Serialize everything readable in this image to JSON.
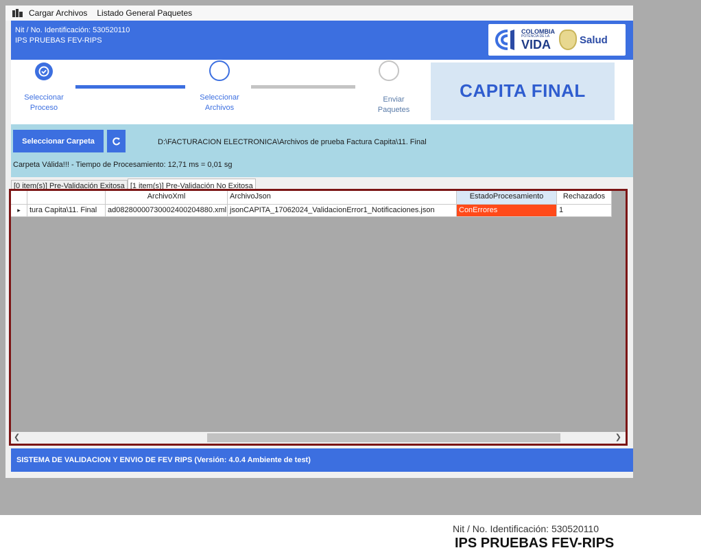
{
  "menubar": {
    "icon": "app-menu-icon",
    "items": [
      "Cargar Archivos",
      "Listado General Paquetes"
    ]
  },
  "header": {
    "nit": "Nit / No. Identificación: 530520110",
    "ips": "IPS PRUEBAS FEV-RIPS",
    "logo": {
      "colombia": "COLOMBIA",
      "potencia": "POTENCIA DE LA",
      "vida": "VIDA",
      "salud": "Salud"
    }
  },
  "stepper": {
    "steps": [
      {
        "label1": "Seleccionar",
        "label2": "Proceso",
        "state": "done"
      },
      {
        "label1": "Seleccionar",
        "label2": "Archivos",
        "state": "current"
      },
      {
        "label1": "Enviar",
        "label2": "Paquetes",
        "state": "pending"
      }
    ],
    "banner": "CAPITA FINAL"
  },
  "folder": {
    "button_label": "Seleccionar Carpeta",
    "refresh_icon": "refresh-icon",
    "path": "D:\\FACTURACION ELECTRONICA\\Archivos de prueba Factura Capita\\11. Final",
    "status": "Carpeta Válida!!! - Tiempo de Procesamiento: 12,71 ms = 0,01 sg"
  },
  "tabs": [
    {
      "label": "[0 item(s)] Pre-Validación Exitosa",
      "active": false
    },
    {
      "label": "[1 item(s)] Pre-Validación No Exitosa",
      "active": true
    }
  ],
  "grid": {
    "columns": [
      "",
      "",
      "ArchivoXml",
      "ArchivoJson",
      "EstadoProcesamiento",
      "Rechazados"
    ],
    "rows": [
      {
        "indicator": "▸",
        "carpeta": "tura Capita\\11. Final",
        "xml": "ad08280000730002400204880.xml",
        "json": "jsonCAPITA_17062024_ValidacionError1_Notificaciones.json",
        "estado": "ConErrores",
        "rechazados": "1"
      }
    ],
    "error_color": "#ff4a1a"
  },
  "footer": {
    "text": "SISTEMA DE VALIDACION Y ENVIO DE FEV RIPS  (Versión: 4.0.4 Ambiente de test)"
  },
  "bottom": {
    "nit": "Nit / No. Identificación: 530520110",
    "ips": "IPS PRUEBAS FEV-RIPS"
  },
  "colors": {
    "primary": "#3c6fe0",
    "panel": "#a9d7e5",
    "banner_bg": "#d7e6f4",
    "grid_border": "#7b1515"
  }
}
